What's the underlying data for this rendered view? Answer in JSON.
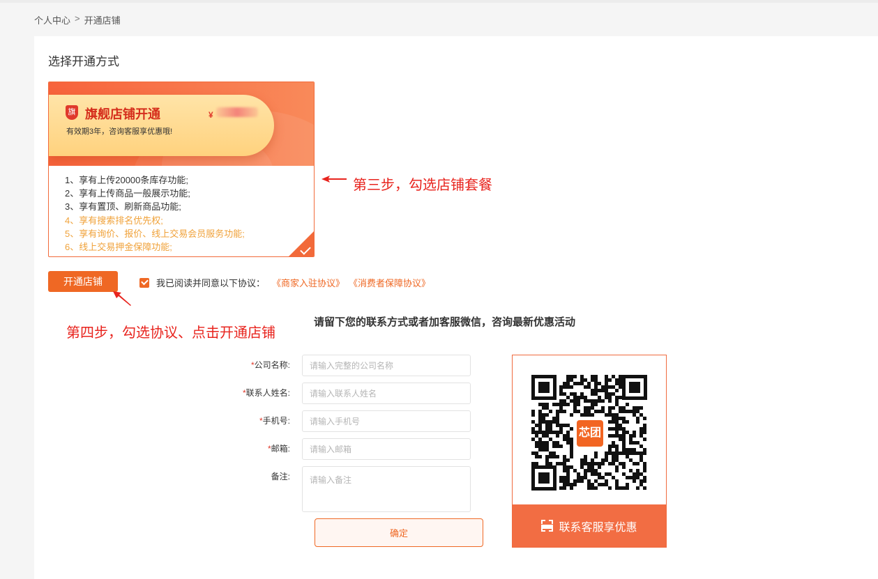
{
  "breadcrumb": {
    "home": "个人中心",
    "separator": ">",
    "current": "开通店铺"
  },
  "section_title": "选择开通方式",
  "package": {
    "shield_char": "旗",
    "name": "旗舰店铺开通",
    "price_symbol": "¥",
    "subtitle": "有效期3年，咨询客服享优惠哦!",
    "features": [
      "1、享有上传20000条库存功能;",
      "2、享有上传商品一般展示功能;",
      "3、享有置顶、刷新商品功能;",
      "4、享有搜索排名优先权;",
      "5、享有询价、报价、线上交易会员服务功能;",
      "6、线上交易押金保障功能;"
    ],
    "selected": true
  },
  "annotations": {
    "step3": "第三步，勾选店铺套餐",
    "step4": "第四步，勾选协议、点击开通店铺"
  },
  "open_button": "开通店铺",
  "agreement": {
    "checked": true,
    "text": "我已阅读并同意以下协议：",
    "link1": "《商家入驻协议》",
    "link2": "《消费者保障协议》"
  },
  "contact_title": "请留下您的联系方式或者加客服微信，咨询最新优惠活动",
  "form": {
    "company": {
      "label": "公司名称:",
      "required": "*",
      "placeholder": "请输入完整的公司名称"
    },
    "contact": {
      "label": "联系人姓名:",
      "required": "*",
      "placeholder": "请输入联系人姓名"
    },
    "phone": {
      "label": "手机号:",
      "required": "*",
      "placeholder": "请输入手机号"
    },
    "email": {
      "label": "邮箱:",
      "required": "*",
      "placeholder": "请输入邮箱"
    },
    "note": {
      "label": "备注:",
      "placeholder": "请输入备注"
    },
    "submit": "确定"
  },
  "qr": {
    "logo_text": "芯团",
    "footer": "联系客服享优惠"
  },
  "colors": {
    "accent": "#ef6824",
    "annotation": "#e8241e",
    "feature_highlight": "#f0a23a"
  }
}
